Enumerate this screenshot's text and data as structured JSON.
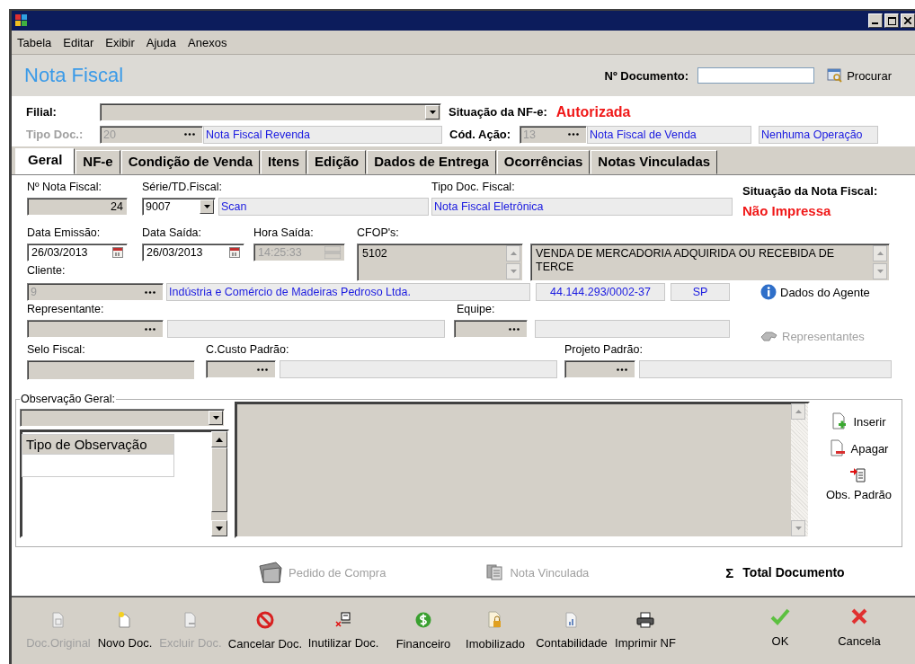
{
  "window": {
    "menu": [
      "Tabela",
      "Editar",
      "Exibir",
      "Ajuda",
      "Anexos"
    ]
  },
  "header": {
    "title": "Nota Fiscal",
    "document_label": "Nº Documento:",
    "search_button": "Procurar"
  },
  "top": {
    "filial_label": "Filial:",
    "tipo_doc": {
      "label": "Tipo Doc.:",
      "code": "20",
      "description": "Nota Fiscal Revenda",
      "disabled": true
    },
    "nfe_status": {
      "label": "Situação da NF-e:",
      "value": "Autorizada"
    },
    "cod_acao": {
      "label": "Cód. Ação:",
      "code": "13",
      "description": "Nota Fiscal de Venda",
      "operation": "Nenhuma Operação",
      "disabled": true
    }
  },
  "tabs": [
    {
      "label": "Geral",
      "selected": true
    },
    {
      "label": "NF-e",
      "selected": false
    },
    {
      "label": "Condição de Venda",
      "selected": false
    },
    {
      "label": "Itens",
      "selected": false
    },
    {
      "label": "Edição",
      "selected": false
    },
    {
      "label": "Dados de Entrega",
      "selected": false
    },
    {
      "label": "Ocorrências",
      "selected": false
    },
    {
      "label": "Notas Vinculadas",
      "selected": false
    }
  ],
  "general": {
    "numero": {
      "label": "Nº Nota Fiscal:",
      "value": "24"
    },
    "serie": {
      "label": "Série/TD.Fiscal:",
      "value": "9007",
      "description": "Scan"
    },
    "tipo_fiscal": {
      "label": "Tipo Doc. Fiscal:",
      "value": "Nota Fiscal Eletrônica"
    },
    "situacao": {
      "label": "Situação da Nota Fiscal:",
      "value": "Não Impressa"
    },
    "data_emissao": {
      "label": "Data Emissão:",
      "value": "26/03/2013"
    },
    "data_saida": {
      "label": "Data Saída:",
      "value": "26/03/2013"
    },
    "hora_saida": {
      "label": "Hora Saída:",
      "value": "14:25:33",
      "disabled": true
    },
    "cfop": {
      "label": "CFOP's:",
      "value": "5102",
      "description": "VENDA DE MERCADORIA ADQUIRIDA OU RECEBIDA DE TERCE"
    },
    "cliente": {
      "label": "Cliente:",
      "code": "9",
      "name": "Indústria e Comércio de Madeiras Pedroso Ltda.",
      "cnpj": "44.144.293/0002-37",
      "uf": "SP"
    },
    "representante": {
      "label": "Representante:"
    },
    "equipe": {
      "label": "Equipe:"
    },
    "selo": {
      "label": "Selo Fiscal:"
    },
    "custo": {
      "label": "C.Custo Padrão:"
    },
    "projeto": {
      "label": "Projeto Padrão:"
    },
    "agent_button": {
      "label": "Dados do Agente",
      "disabled": false
    },
    "representatives_button": {
      "label": "Representantes",
      "disabled": true
    }
  },
  "observation": {
    "legend": "Observação Geral:",
    "list": [
      {
        "label": "Tipo de Observação",
        "selected": true
      }
    ],
    "actions": [
      {
        "label": "Inserir",
        "kind": "add"
      },
      {
        "label": "Apagar",
        "kind": "delete"
      },
      {
        "label": "Obs. Padrão",
        "kind": "standard"
      }
    ]
  },
  "links": [
    {
      "label": "Pedido de Compra",
      "kind": "order",
      "disabled": true
    },
    {
      "label": "Nota Vinculada",
      "kind": "linked",
      "disabled": true
    },
    {
      "label": "Total Documento",
      "kind": "total",
      "symbol": "Σ",
      "disabled": false
    }
  ],
  "toolbar": [
    {
      "label": "Doc.Original",
      "kind": "original",
      "disabled": true
    },
    {
      "label": "Novo Doc.",
      "kind": "new",
      "disabled": false
    },
    {
      "label": "Excluir Doc.",
      "kind": "delete",
      "disabled": true
    },
    {
      "label": "Cancelar Doc.",
      "kind": "cancel",
      "disabled": false
    },
    {
      "label": "Inutilizar Doc.",
      "kind": "void",
      "disabled": false
    },
    {
      "label": "Financeiro",
      "kind": "finance",
      "disabled": false
    },
    {
      "label": "Imobilizado",
      "kind": "asset",
      "disabled": false
    },
    {
      "label": "Contabilidade",
      "kind": "accounting",
      "disabled": false
    },
    {
      "label": "Imprimir NF",
      "kind": "print",
      "disabled": false
    }
  ],
  "dialog_buttons": [
    {
      "label": "OK",
      "kind": "ok"
    },
    {
      "label": "Cancela",
      "kind": "close"
    }
  ]
}
